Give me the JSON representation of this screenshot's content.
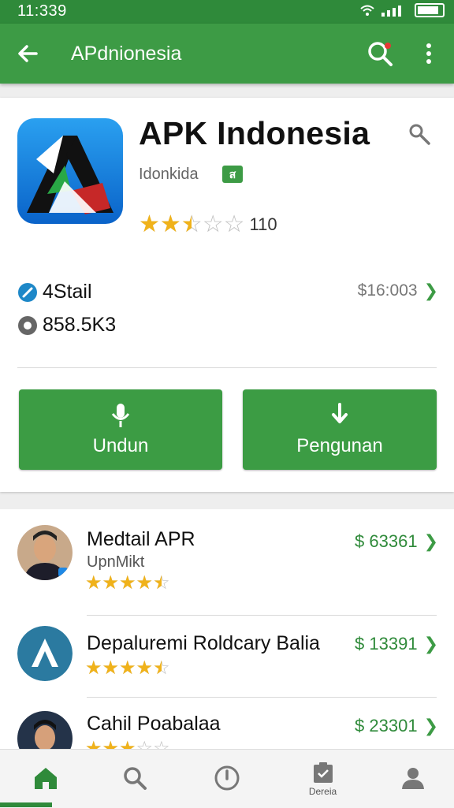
{
  "status_bar": {
    "time": "11:339"
  },
  "app_bar": {
    "title": "APdnionesia"
  },
  "app": {
    "name": "APK Indonesia",
    "developer": "Idonkida",
    "badge": "ส",
    "rating": {
      "value": 2.5,
      "max": 5,
      "count": "110"
    },
    "stats": {
      "version": "4Stail",
      "size": "858.5K3"
    },
    "price": "$16:003",
    "buttons": {
      "download": "Undun",
      "secondary": "Pengunan"
    }
  },
  "list": [
    {
      "title": "Medtail APR",
      "subtitle": "UpnMikt",
      "rating": 4.5,
      "price": "$ 63361"
    },
    {
      "title": "Depaluremi Roldcary Balia",
      "subtitle": "",
      "rating": 4.5,
      "price": "$ 13391"
    },
    {
      "title": "Cahil Poabalaa",
      "subtitle": "",
      "rating": 3,
      "price": "$ 23301"
    }
  ],
  "bottom_nav": [
    {
      "icon": "home-icon",
      "label": "",
      "active": true
    },
    {
      "icon": "search-icon",
      "label": "",
      "active": false
    },
    {
      "icon": "compass-icon",
      "label": "",
      "active": false
    },
    {
      "icon": "clipboard-icon",
      "label": "Dereia",
      "active": false
    },
    {
      "icon": "profile-icon",
      "label": "",
      "active": false
    }
  ],
  "colors": {
    "accent": "#3d9b45",
    "status_bar": "#2f8a3a",
    "star": "#f0b21a"
  }
}
